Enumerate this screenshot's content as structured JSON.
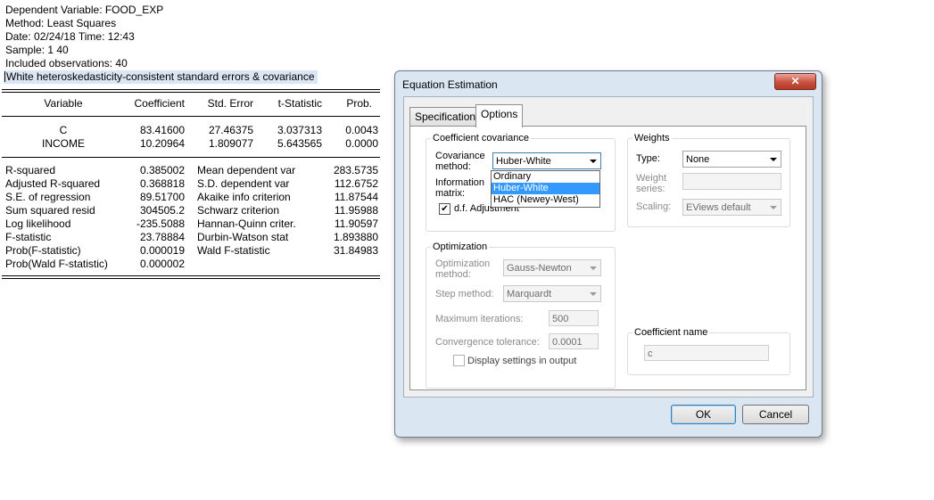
{
  "output": {
    "header": [
      "Dependent Variable: FOOD_EXP",
      "Method: Least Squares",
      "Date: 02/24/18   Time: 12:43",
      "Sample: 1 40",
      "Included observations: 40"
    ],
    "note": "White heteroskedasticity-consistent standard errors & covariance",
    "columns": [
      "Variable",
      "Coefficient",
      "Std. Error",
      "t-Statistic",
      "Prob."
    ],
    "rows": [
      [
        "C",
        "83.41600",
        "27.46375",
        "3.037313",
        "0.0043"
      ],
      [
        "INCOME",
        "10.20964",
        "1.809077",
        "5.643565",
        "0.0000"
      ]
    ],
    "stats": [
      [
        "R-squared",
        "0.385002",
        "Mean dependent var",
        "283.5735"
      ],
      [
        "Adjusted R-squared",
        "0.368818",
        "S.D. dependent var",
        "112.6752"
      ],
      [
        "S.E. of regression",
        "89.51700",
        "Akaike info criterion",
        "11.87544"
      ],
      [
        "Sum squared resid",
        "304505.2",
        "Schwarz criterion",
        "11.95988"
      ],
      [
        "Log likelihood",
        "-235.5088",
        "Hannan-Quinn criter.",
        "11.90597"
      ],
      [
        "F-statistic",
        "23.78884",
        "Durbin-Watson stat",
        "1.893880"
      ],
      [
        "Prob(F-statistic)",
        "0.000019",
        "Wald F-statistic",
        "31.84983"
      ],
      [
        "Prob(Wald F-statistic)",
        "0.000002",
        "",
        ""
      ]
    ]
  },
  "dialog": {
    "title": "Equation Estimation",
    "close_glyph": "✕",
    "tabs": [
      "Specification",
      "Options"
    ],
    "coef_cov": {
      "title": "Coefficient covariance",
      "method_label_1": "Covariance",
      "method_label_2": "method:",
      "method_value": "Huber-White",
      "info_label_1": "Information",
      "info_label_2": "matrix:",
      "dropdown_options": [
        "Ordinary",
        "Huber-White",
        "HAC (Newey-West)"
      ],
      "selected_option": "Huber-White",
      "df_label": "d.f. Adjustment",
      "df_checked": true
    },
    "weights": {
      "title": "Weights",
      "type_label": "Type:",
      "type_value": "None",
      "series_label_1": "Weight",
      "series_label_2": "series:",
      "scaling_label": "Scaling:",
      "scaling_value": "EViews default"
    },
    "optimization": {
      "title": "Optimization",
      "method_label_1": "Optimization",
      "method_label_2": "method:",
      "method_value": "Gauss-Newton",
      "step_label": "Step method:",
      "step_value": "Marquardt",
      "maxiter_label": "Maximum iterations:",
      "maxiter_value": "500",
      "tol_label": "Convergence tolerance:",
      "tol_value": "0.0001",
      "display_label": "Display settings in output",
      "display_checked": false
    },
    "coef_name": {
      "title": "Coefficient name",
      "value": "c"
    },
    "ok_label": "OK",
    "cancel_label": "Cancel"
  }
}
